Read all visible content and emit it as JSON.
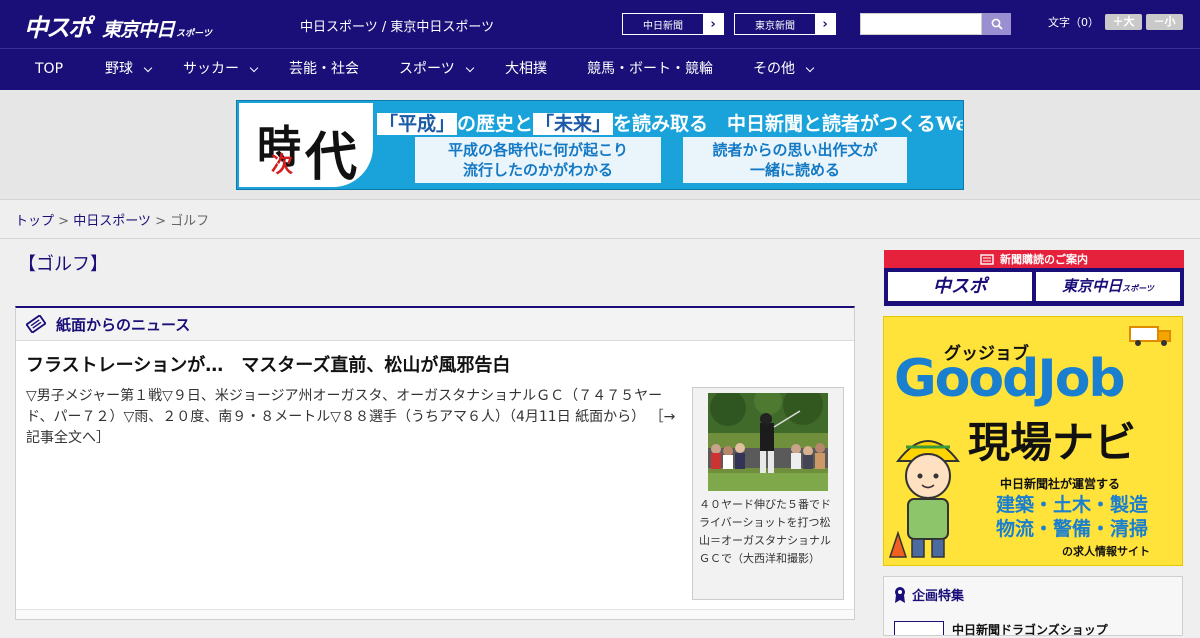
{
  "header": {
    "logo_chuspo": "中スポ",
    "logo_tokyo": "東京中日",
    "logo_tokyo_small": "スポーツ",
    "site_links": "中日スポーツ / 東京中日スポーツ",
    "paper_buttons": [
      "中日新聞",
      "東京新聞"
    ],
    "search_placeholder": "",
    "font_size_label": "文字（0）",
    "font_bigger": "＋大",
    "font_smaller": "－小"
  },
  "nav": {
    "items": [
      {
        "label": "TOP"
      },
      {
        "label": "野球"
      },
      {
        "label": "サッカー"
      },
      {
        "label": "芸能・社会"
      },
      {
        "label": "スポーツ"
      },
      {
        "label": "大相撲"
      },
      {
        "label": "競馬・ボート・競輪"
      },
      {
        "label": "その他"
      }
    ]
  },
  "banner": {
    "logo_ji": "時",
    "logo_tsugi": "次",
    "logo_dai": "代",
    "head_q1": "「平成」",
    "head_t1": "の歴史と",
    "head_q2": "「未来」",
    "head_t2": "を読み取る　中日新聞と読者がつくるWebサイト",
    "box1_line1": "平成の各時代に何が起こり",
    "box1_line2": "流行したのかがわかる",
    "box2_line1": "読者からの思い出作文が",
    "box2_line2": "一緒に読める"
  },
  "breadcrumb": {
    "top": "トップ",
    "sep": " > ",
    "section": "中日スポーツ",
    "current": "ゴルフ"
  },
  "page": {
    "title": "【ゴルフ】"
  },
  "news": {
    "heading": "紙面からのニュース",
    "article_title": "フラストレーションが…　マスターズ直前、松山が風邪告白",
    "article_body": "▽男子メジャー第１戦▽９日、米ジョージア州オーガスタ、オーガスタナショナルＧＣ（７４７５ヤード、パー７２）▽雨、２０度、南９・８メートル▽８８選手（うちアマ６人）（4月11日 紙面から）",
    "article_more": "［→記事全文へ］",
    "photo_caption": "４０ヤード伸びた５番でドライバーショットを打つ松山＝オーガスタナショナルＧＣで（大西洋和撮影）"
  },
  "sidebar": {
    "subscribe_title": "新聞購読のご案内",
    "subscribe_chuspo": "中スポ",
    "subscribe_tokyo": "東京中日",
    "subscribe_tokyo_small": "スポーツ",
    "goodjob_small": "グッジョブ",
    "goodjob_title": "GoodJob",
    "goodjob_sub": "現場ナビ",
    "goodjob_note": "中日新聞社が運営する",
    "goodjob_cats1": "建築・土木・製造",
    "goodjob_cats2": "物流・警備・清掃",
    "goodjob_foot": "の求人情報サイト",
    "features_title": "企画特集",
    "feature_item": "中日新聞ドラゴンズショップ"
  },
  "colors": {
    "brand_navy": "#1a0f78",
    "subscribe_red": "#e6213c",
    "banner_blue": "#19a3da",
    "goodjob_yellow": "#ffe33a"
  }
}
